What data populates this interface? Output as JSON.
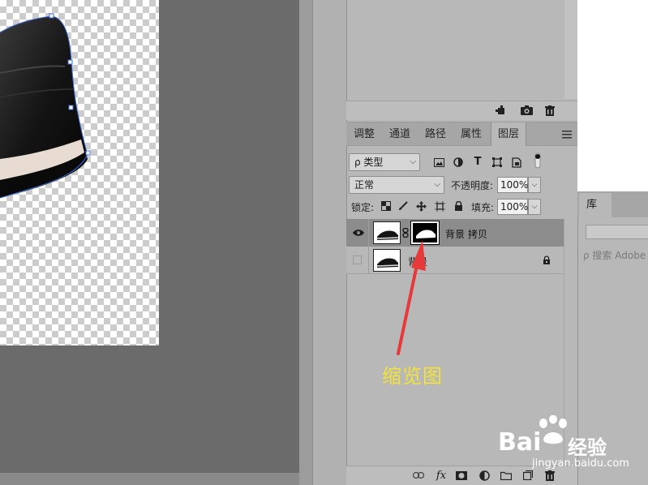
{
  "upper_footer_icons": [
    "new-adjustment-icon",
    "camera-icon",
    "trash-icon"
  ],
  "tabs": [
    {
      "label": "调整"
    },
    {
      "label": "通道"
    },
    {
      "label": "路径"
    },
    {
      "label": "属性"
    },
    {
      "label": "图层",
      "active": true
    }
  ],
  "filter": {
    "kind_label": "ρ 类型"
  },
  "blend": {
    "mode": "正常",
    "opacity_label": "不透明度:",
    "opacity_value": "100%"
  },
  "lock": {
    "label": "锁定:",
    "fill_label": "填充:",
    "fill_value": "100%"
  },
  "layers": [
    {
      "name": "背景 拷贝",
      "visible": true,
      "selected": true,
      "has_mask": true,
      "locked": false
    },
    {
      "name": "背景",
      "visible": false,
      "selected": false,
      "has_mask": false,
      "locked": true
    }
  ],
  "footer_icons": [
    "link-icon",
    "fx-icon",
    "mask-icon",
    "adjustment-icon",
    "folder-icon",
    "new-layer-icon",
    "trash-icon"
  ],
  "library": {
    "tab_label": "库",
    "search_placeholder": "ρ 搜索 Adobe"
  },
  "annotation": {
    "text": "缩览图"
  },
  "watermark": {
    "brand": "Bai",
    "brand2": "经验",
    "url": "jingyan.baidu.com"
  },
  "colors": {
    "arrow": "#e63a3a",
    "annotation": "#f2e23a",
    "panel": "#b8b8b8",
    "selected_layer": "#8c8c8c"
  }
}
